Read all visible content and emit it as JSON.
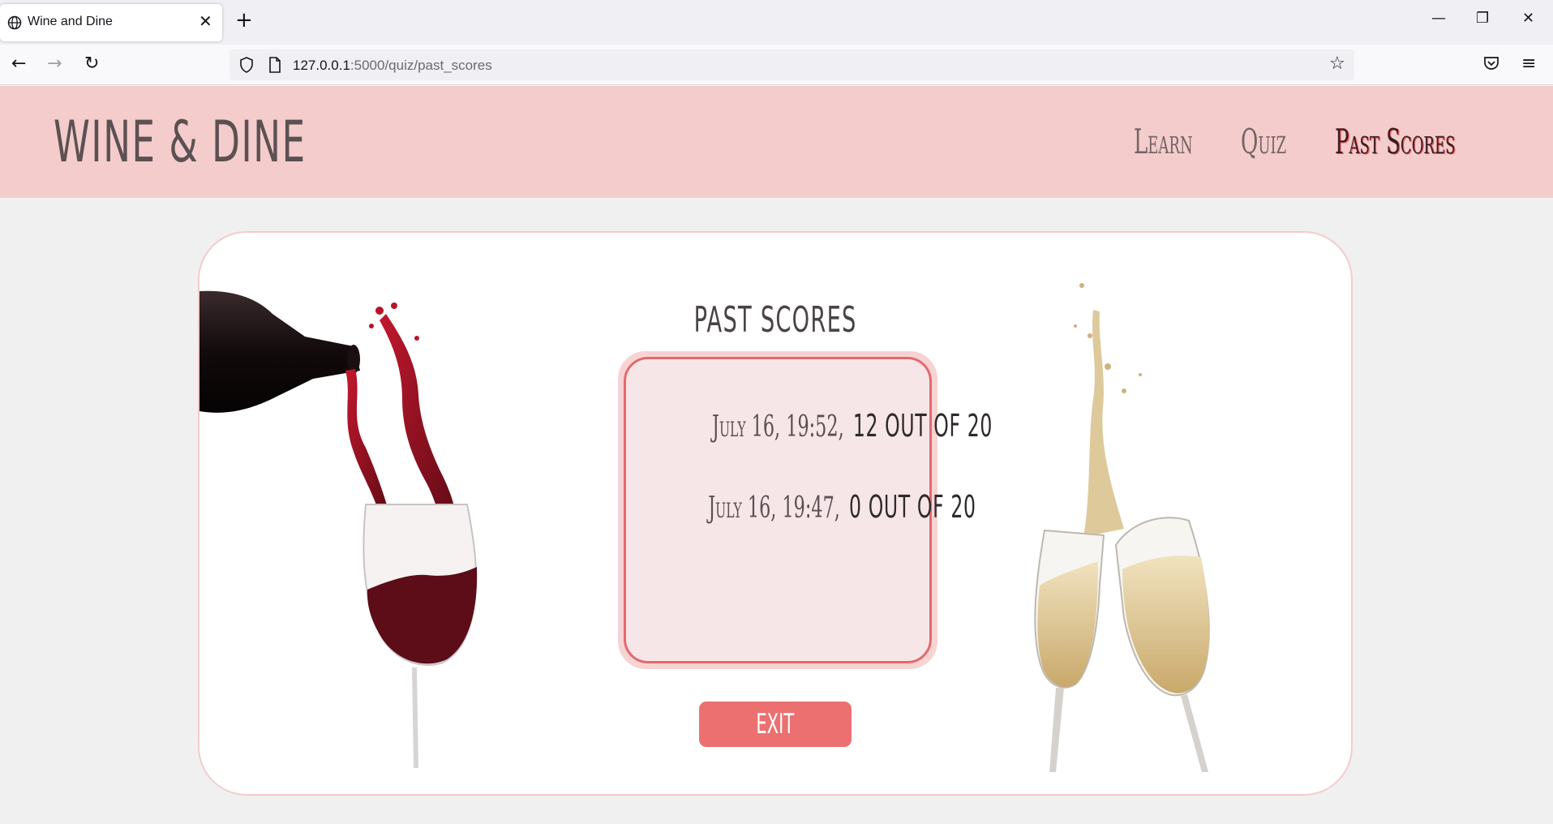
{
  "browser": {
    "tab_title": "Wine and Dine",
    "tab_close": "✕",
    "new_tab": "+",
    "url_host": "127.0.0.1",
    "url_path": ":5000/quiz/past_scores",
    "back": "←",
    "forward": "→",
    "reload": "↻",
    "bookmark": "☆",
    "menu": "≡",
    "minimize": "—",
    "restore": "❐",
    "close": "✕"
  },
  "header": {
    "brand": "WINE & DINE",
    "nav": [
      {
        "label": "Learn"
      },
      {
        "label": "Quiz"
      },
      {
        "label": "Past Scores"
      }
    ]
  },
  "main": {
    "title": "PAST SCORES",
    "scores": [
      {
        "date": "July 16, 19:52,",
        "result": "12 OUT OF 20"
      },
      {
        "date": "July 16, 19:47,",
        "result": "0 OUT OF 20"
      }
    ],
    "exit_label": "EXIT"
  },
  "colors": {
    "header_bg": "#f4cccc",
    "accent": "#ec7070",
    "score_box_bg": "#f7e6e7",
    "score_box_border": "#e26a6e"
  }
}
